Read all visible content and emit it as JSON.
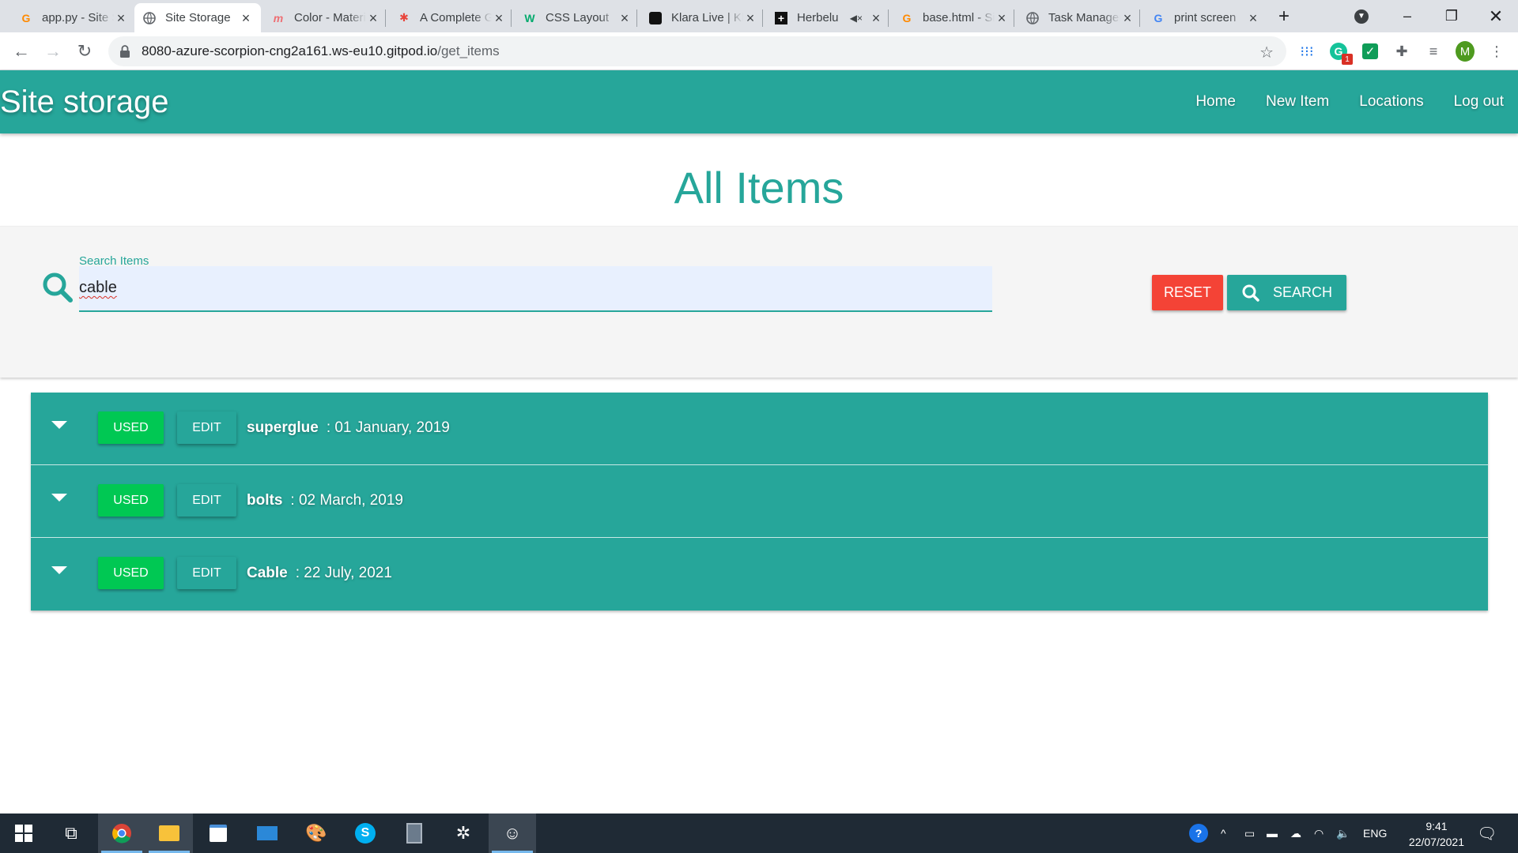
{
  "browser": {
    "tabs": [
      {
        "title": "app.py - Site Storage",
        "favicon": "gitpod-orange-icon",
        "active": false
      },
      {
        "title": "Site Storage",
        "favicon": "globe-icon",
        "active": true
      },
      {
        "title": "Color - Materialize",
        "favicon": "materialize-icon",
        "active": false
      },
      {
        "title": "A Complete Guide",
        "favicon": "asterisk-icon",
        "active": false
      },
      {
        "title": "CSS Layout",
        "favicon": "w3schools-icon",
        "active": false
      },
      {
        "title": "Klara Live | Klara",
        "favicon": "klara-icon",
        "active": false
      },
      {
        "title": "Herbelu",
        "favicon": "plus-icon",
        "active": false
      },
      {
        "title": "base.html - Site",
        "favicon": "gitpod-orange-icon",
        "active": false
      },
      {
        "title": "Task Manager",
        "favicon": "globe-icon",
        "active": false
      },
      {
        "title": "print screen",
        "favicon": "google-icon",
        "active": false
      }
    ],
    "url_host": "8080-azure-scorpion-cng2a161.ws-eu10.gitpod.io",
    "url_path": "/get_items",
    "profile_initial": "M",
    "extension_badge": "1"
  },
  "site": {
    "brand": "Site storage",
    "nav": [
      "Home",
      "New Item",
      "Locations",
      "Log out"
    ],
    "heading": "All Items",
    "search": {
      "label": "Search Items",
      "value": "cable",
      "reset_label": "Reset",
      "search_label": "Search"
    },
    "items": [
      {
        "name": "superglue",
        "date": ": 01 January, 2019",
        "used_label": "USED",
        "edit_label": "EDIT"
      },
      {
        "name": "bolts",
        "date": ": 02 March, 2019",
        "used_label": "USED",
        "edit_label": "EDIT"
      },
      {
        "name": "Cable",
        "date": ": 22 July, 2021",
        "used_label": "USED",
        "edit_label": "EDIT"
      }
    ]
  },
  "taskbar": {
    "language": "ENG",
    "time": "9:41",
    "date": "22/07/2021"
  },
  "colors": {
    "primary": "#26a69a",
    "reset": "#f44336",
    "used": "#00c853"
  }
}
